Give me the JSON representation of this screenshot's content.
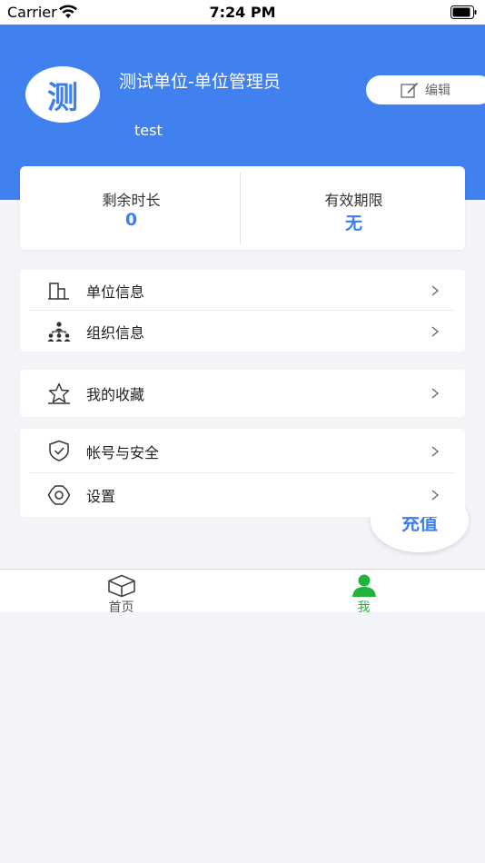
{
  "status_bar": {
    "carrier": "Carrier",
    "time": "7:24 PM",
    "icons": [
      "wifi-icon",
      "battery-icon"
    ]
  },
  "profile": {
    "avatar_char": "测",
    "name": "测试单位-单位管理员",
    "account": "test",
    "edit_label": "编辑",
    "edit_icon": "edit-icon"
  },
  "stats": {
    "remaining_label": "剩余时长",
    "remaining_value": "0",
    "validity_label": "有效期限",
    "validity_value": "无"
  },
  "menu": {
    "groups": [
      [
        {
          "label": "单位信息",
          "icon": "building-icon"
        },
        {
          "label": "组织信息",
          "icon": "org-chart-icon"
        }
      ],
      [
        {
          "label": "我的收藏",
          "icon": "star-icon"
        }
      ],
      [
        {
          "label": "帐号与安全",
          "icon": "shield-check-icon"
        },
        {
          "label": "设置",
          "icon": "gear-icon"
        }
      ]
    ]
  },
  "recharge": {
    "label": "充值"
  },
  "tab_bar": {
    "tabs": [
      {
        "label": "首页",
        "icon": "cube-icon",
        "active": false
      },
      {
        "label": "我",
        "icon": "person-icon",
        "active": true
      }
    ]
  },
  "colors": {
    "header_blue": "#4181ef",
    "accent_blue": "#3d7ff0",
    "active_green": "#22b33c",
    "background": "#f3f4f8"
  }
}
